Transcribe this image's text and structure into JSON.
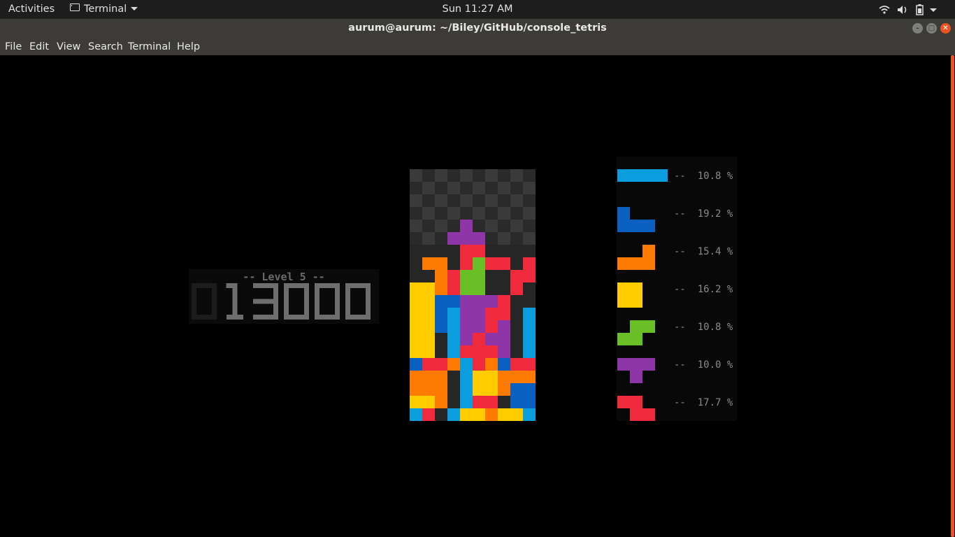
{
  "topbar": {
    "activities": "Activities",
    "app_name": "Terminal",
    "clock": "Sun 11:27 AM",
    "tray_icons": [
      "wifi-icon",
      "volume-icon",
      "battery-icon",
      "system-menu-caret-icon"
    ]
  },
  "window": {
    "title": "aurum@aurum: ~/Biley/GitHub/console_tetris",
    "buttons": [
      "minimize",
      "maximize",
      "close"
    ]
  },
  "menu": {
    "items": [
      "File",
      "Edit",
      "View",
      "Search",
      "Terminal",
      "Help"
    ]
  },
  "game": {
    "level_label": "-- Level 5 --",
    "score_display": "013000",
    "colors": {
      "I": "#0a9ede",
      "J": "#0a60c0",
      "L": "#ff7a00",
      "O": "#ffcc00",
      "S": "#6abf26",
      "T": "#8e35a8",
      "Z": "#ee2a3c",
      "board_light": "#3a3a3a",
      "board_dark": "#2a2a2a",
      "stack_empty": "#262626"
    },
    "board": [
      "..........",
      "..........",
      "..........",
      "..........",
      "....T.....",
      "...TTT....",
      "....ZZ....",
      ".LL.ZSZZ.Z",
      "..LZSS..ZZ",
      "OOLZSS..Z.",
      "OOJJTTTZ..",
      "OOJITTZZ.I",
      "OOJITTZT.I",
      "OO.ITZTT.I",
      "OO.IZZZT.I",
      "JZZLIZLJZZ",
      "LLL.IOOLLL",
      "LLL.IOOLJJ",
      "OOL.IZZ.JJ",
      "IZ.IOOLOOI"
    ],
    "stats": [
      {
        "piece": "I",
        "dashes": "--",
        "percent": "10.8 %"
      },
      {
        "piece": "J",
        "dashes": "--",
        "percent": "19.2 %"
      },
      {
        "piece": "L",
        "dashes": "--",
        "percent": "15.4 %"
      },
      {
        "piece": "O",
        "dashes": "--",
        "percent": "16.2 %"
      },
      {
        "piece": "S",
        "dashes": "--",
        "percent": "10.8 %"
      },
      {
        "piece": "T",
        "dashes": "--",
        "percent": "10.0 %"
      },
      {
        "piece": "Z",
        "dashes": "--",
        "percent": "17.7 %"
      }
    ]
  }
}
